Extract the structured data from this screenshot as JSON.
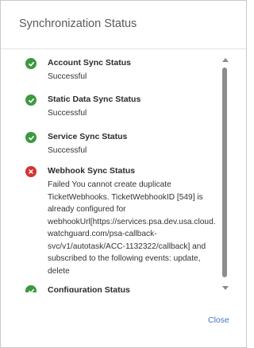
{
  "dialog": {
    "title": "Synchronization Status",
    "close_label": "Close"
  },
  "statuses": [
    {
      "title": "Account Sync Status",
      "detail": "Successful",
      "state": "success",
      "icon": "check-circle-icon"
    },
    {
      "title": "Static Data Sync Status",
      "detail": "Successful",
      "state": "success",
      "icon": "check-circle-icon"
    },
    {
      "title": "Service Sync Status",
      "detail": "Successful",
      "state": "success",
      "icon": "check-circle-icon"
    },
    {
      "title": "Webhook Sync Status",
      "detail": "Failed You cannot create duplicate\nTicketWebhooks. TicketWebhookID [549] is\nalready configured for\nwebhookUrl[https://services.psa.dev.usa.cloud.\nwatchguard.com/psa-callback-\nsvc/v1/autotask/ACC-1132322/callback] and\nsubscribed to the following events: update,\ndelete",
      "state": "error",
      "icon": "error-circle-icon"
    },
    {
      "title": "Configuration Status",
      "detail": "",
      "state": "success",
      "icon": "check-circle-icon"
    }
  ],
  "colors": {
    "success": "#3a9a3f",
    "error": "#d7322e",
    "link": "#3d78c6"
  }
}
